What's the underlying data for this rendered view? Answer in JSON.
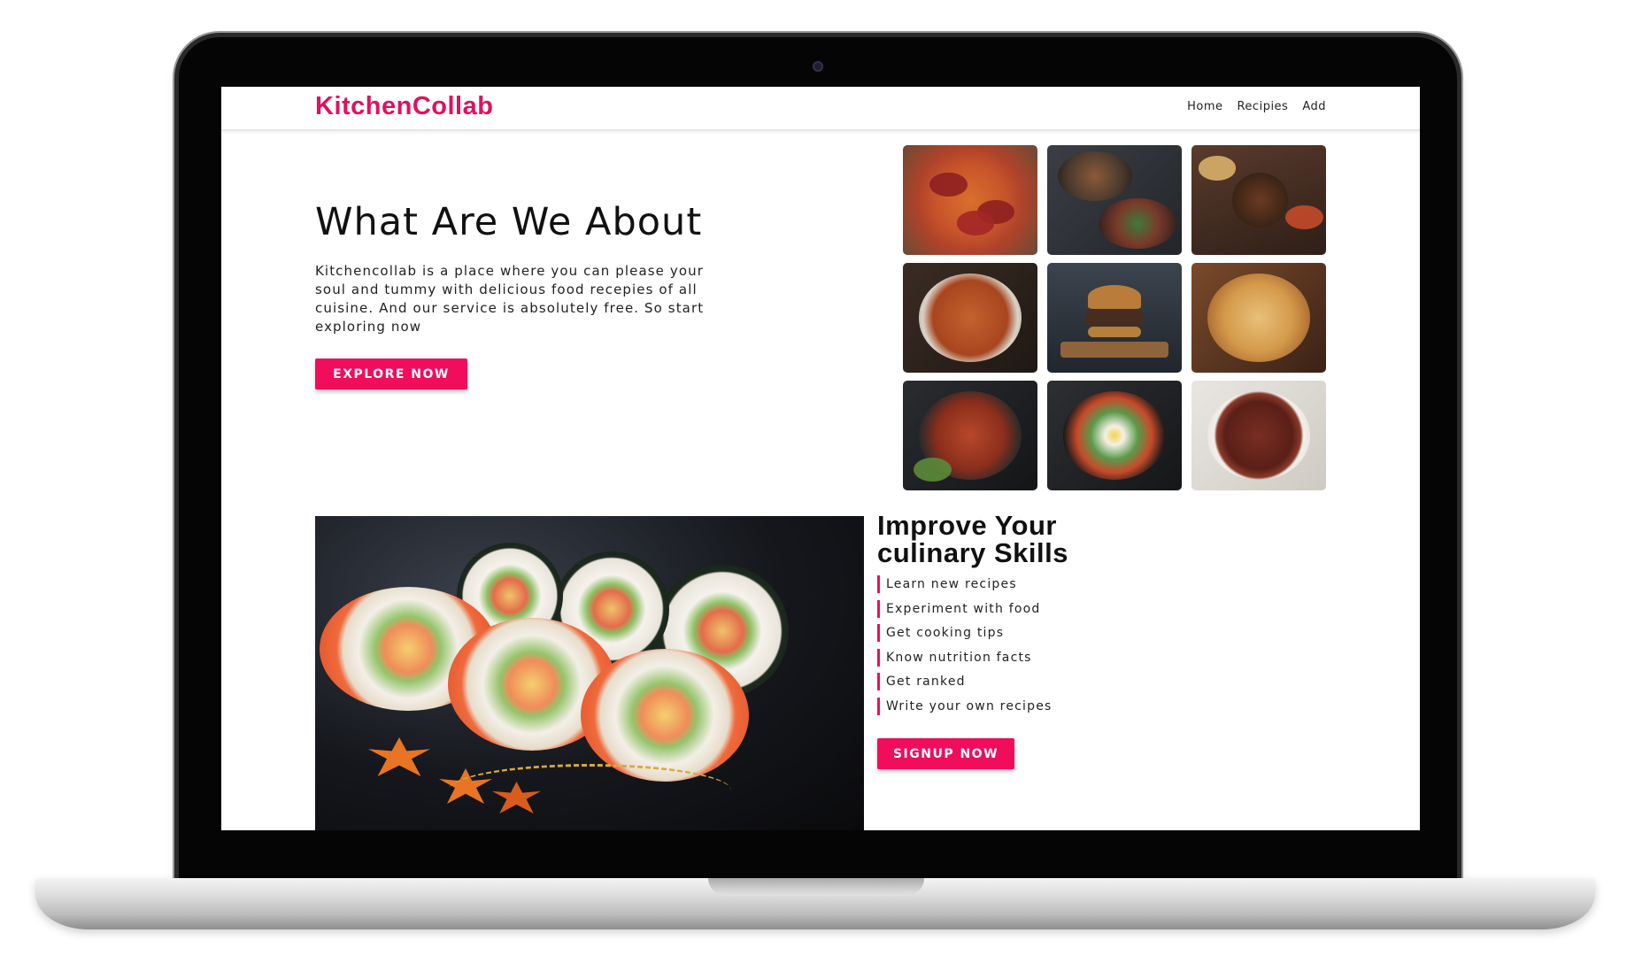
{
  "site": {
    "brand": "KitchenCollab",
    "brand_color": "#e0115f",
    "nav": [
      {
        "label": "Home"
      },
      {
        "label": "Recipies"
      },
      {
        "label": "Add"
      }
    ]
  },
  "hero": {
    "title": "What Are We About",
    "description": "Kitchencollab is a place where you can please your soul and tummy with delicious food recepies of all cuisine. And our service is absolutely free. So start exploring now",
    "button_label": "EXPLORE NOW",
    "accent_color": "#f10c5c"
  },
  "food_grid": [
    {
      "image": "pizza-photo"
    },
    {
      "image": "noodle-bowls-photo"
    },
    {
      "image": "asian-dishes-photo"
    },
    {
      "image": "spaghetti-meatballs-photo"
    },
    {
      "image": "burger-photo"
    },
    {
      "image": "biryani-photo"
    },
    {
      "image": "grilled-chicken-photo"
    },
    {
      "image": "bibimbap-photo"
    },
    {
      "image": "steak-photo"
    }
  ],
  "skills": {
    "title": "Improve Your culinary Skills",
    "items": [
      "Learn new recipes",
      "Experiment with food",
      "Get cooking tips",
      "Know nutrition facts",
      "Get ranked",
      "Write your own recipes"
    ],
    "button_label": "SIGNUP NOW",
    "image": "sushi-photo"
  }
}
